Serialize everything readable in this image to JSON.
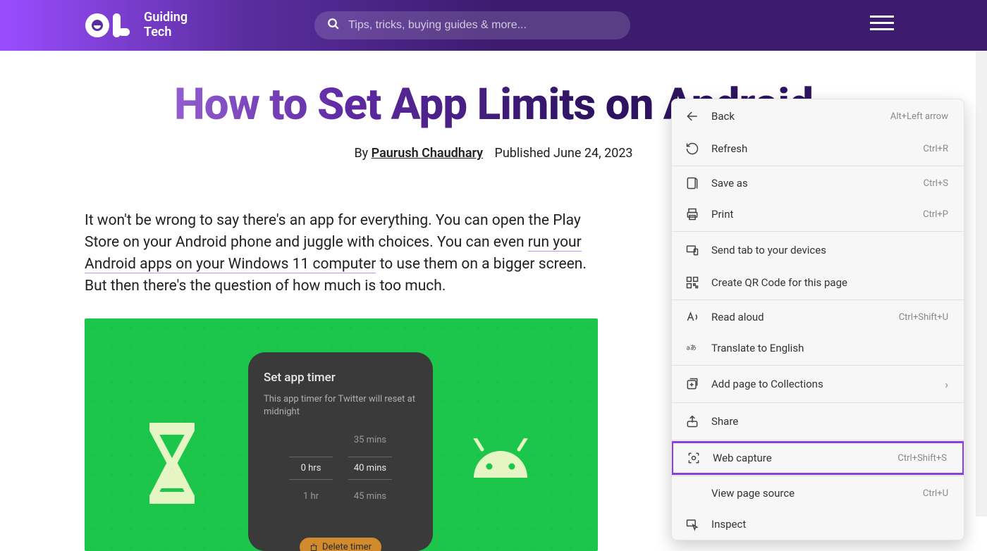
{
  "brand": {
    "line1": "Guiding",
    "line2": "Tech"
  },
  "search": {
    "placeholder": "Tips, tricks, buying guides & more..."
  },
  "title": "How to Set App Limits on Android",
  "byline": {
    "by": "By",
    "author": "Paurush Chaudhary",
    "published": "Published June 24, 2023"
  },
  "article": {
    "p1a": "It won't be wrong to say there's an app for everything. You can open the Play Store on your Android phone and juggle with choices. You can even ",
    "link": "run your Android apps on your Windows 11 computer",
    "p1b": " to use them on a bigger screen. But then there's the question of how much is too much."
  },
  "phone": {
    "title": "Set app timer",
    "subtitle": "This app timer for Twitter will reset at midnight",
    "row_top_right": "35 mins",
    "row_mid_left": "0 hrs",
    "row_mid_right": "40 mins",
    "row_bot_left": "1 hr",
    "row_bot_right": "45 mins",
    "delete": "Delete timer"
  },
  "menu": {
    "back": "Back",
    "back_sc": "Alt+Left arrow",
    "refresh": "Refresh",
    "refresh_sc": "Ctrl+R",
    "saveas": "Save as",
    "saveas_sc": "Ctrl+S",
    "print": "Print",
    "print_sc": "Ctrl+P",
    "sendtab": "Send tab to your devices",
    "qrcode": "Create QR Code for this page",
    "readaloud": "Read aloud",
    "readaloud_sc": "Ctrl+Shift+U",
    "translate": "Translate to English",
    "collections": "Add page to Collections",
    "share": "Share",
    "webcapture": "Web capture",
    "webcapture_sc": "Ctrl+Shift+S",
    "viewsource": "View page source",
    "viewsource_sc": "Ctrl+U",
    "inspect": "Inspect"
  }
}
